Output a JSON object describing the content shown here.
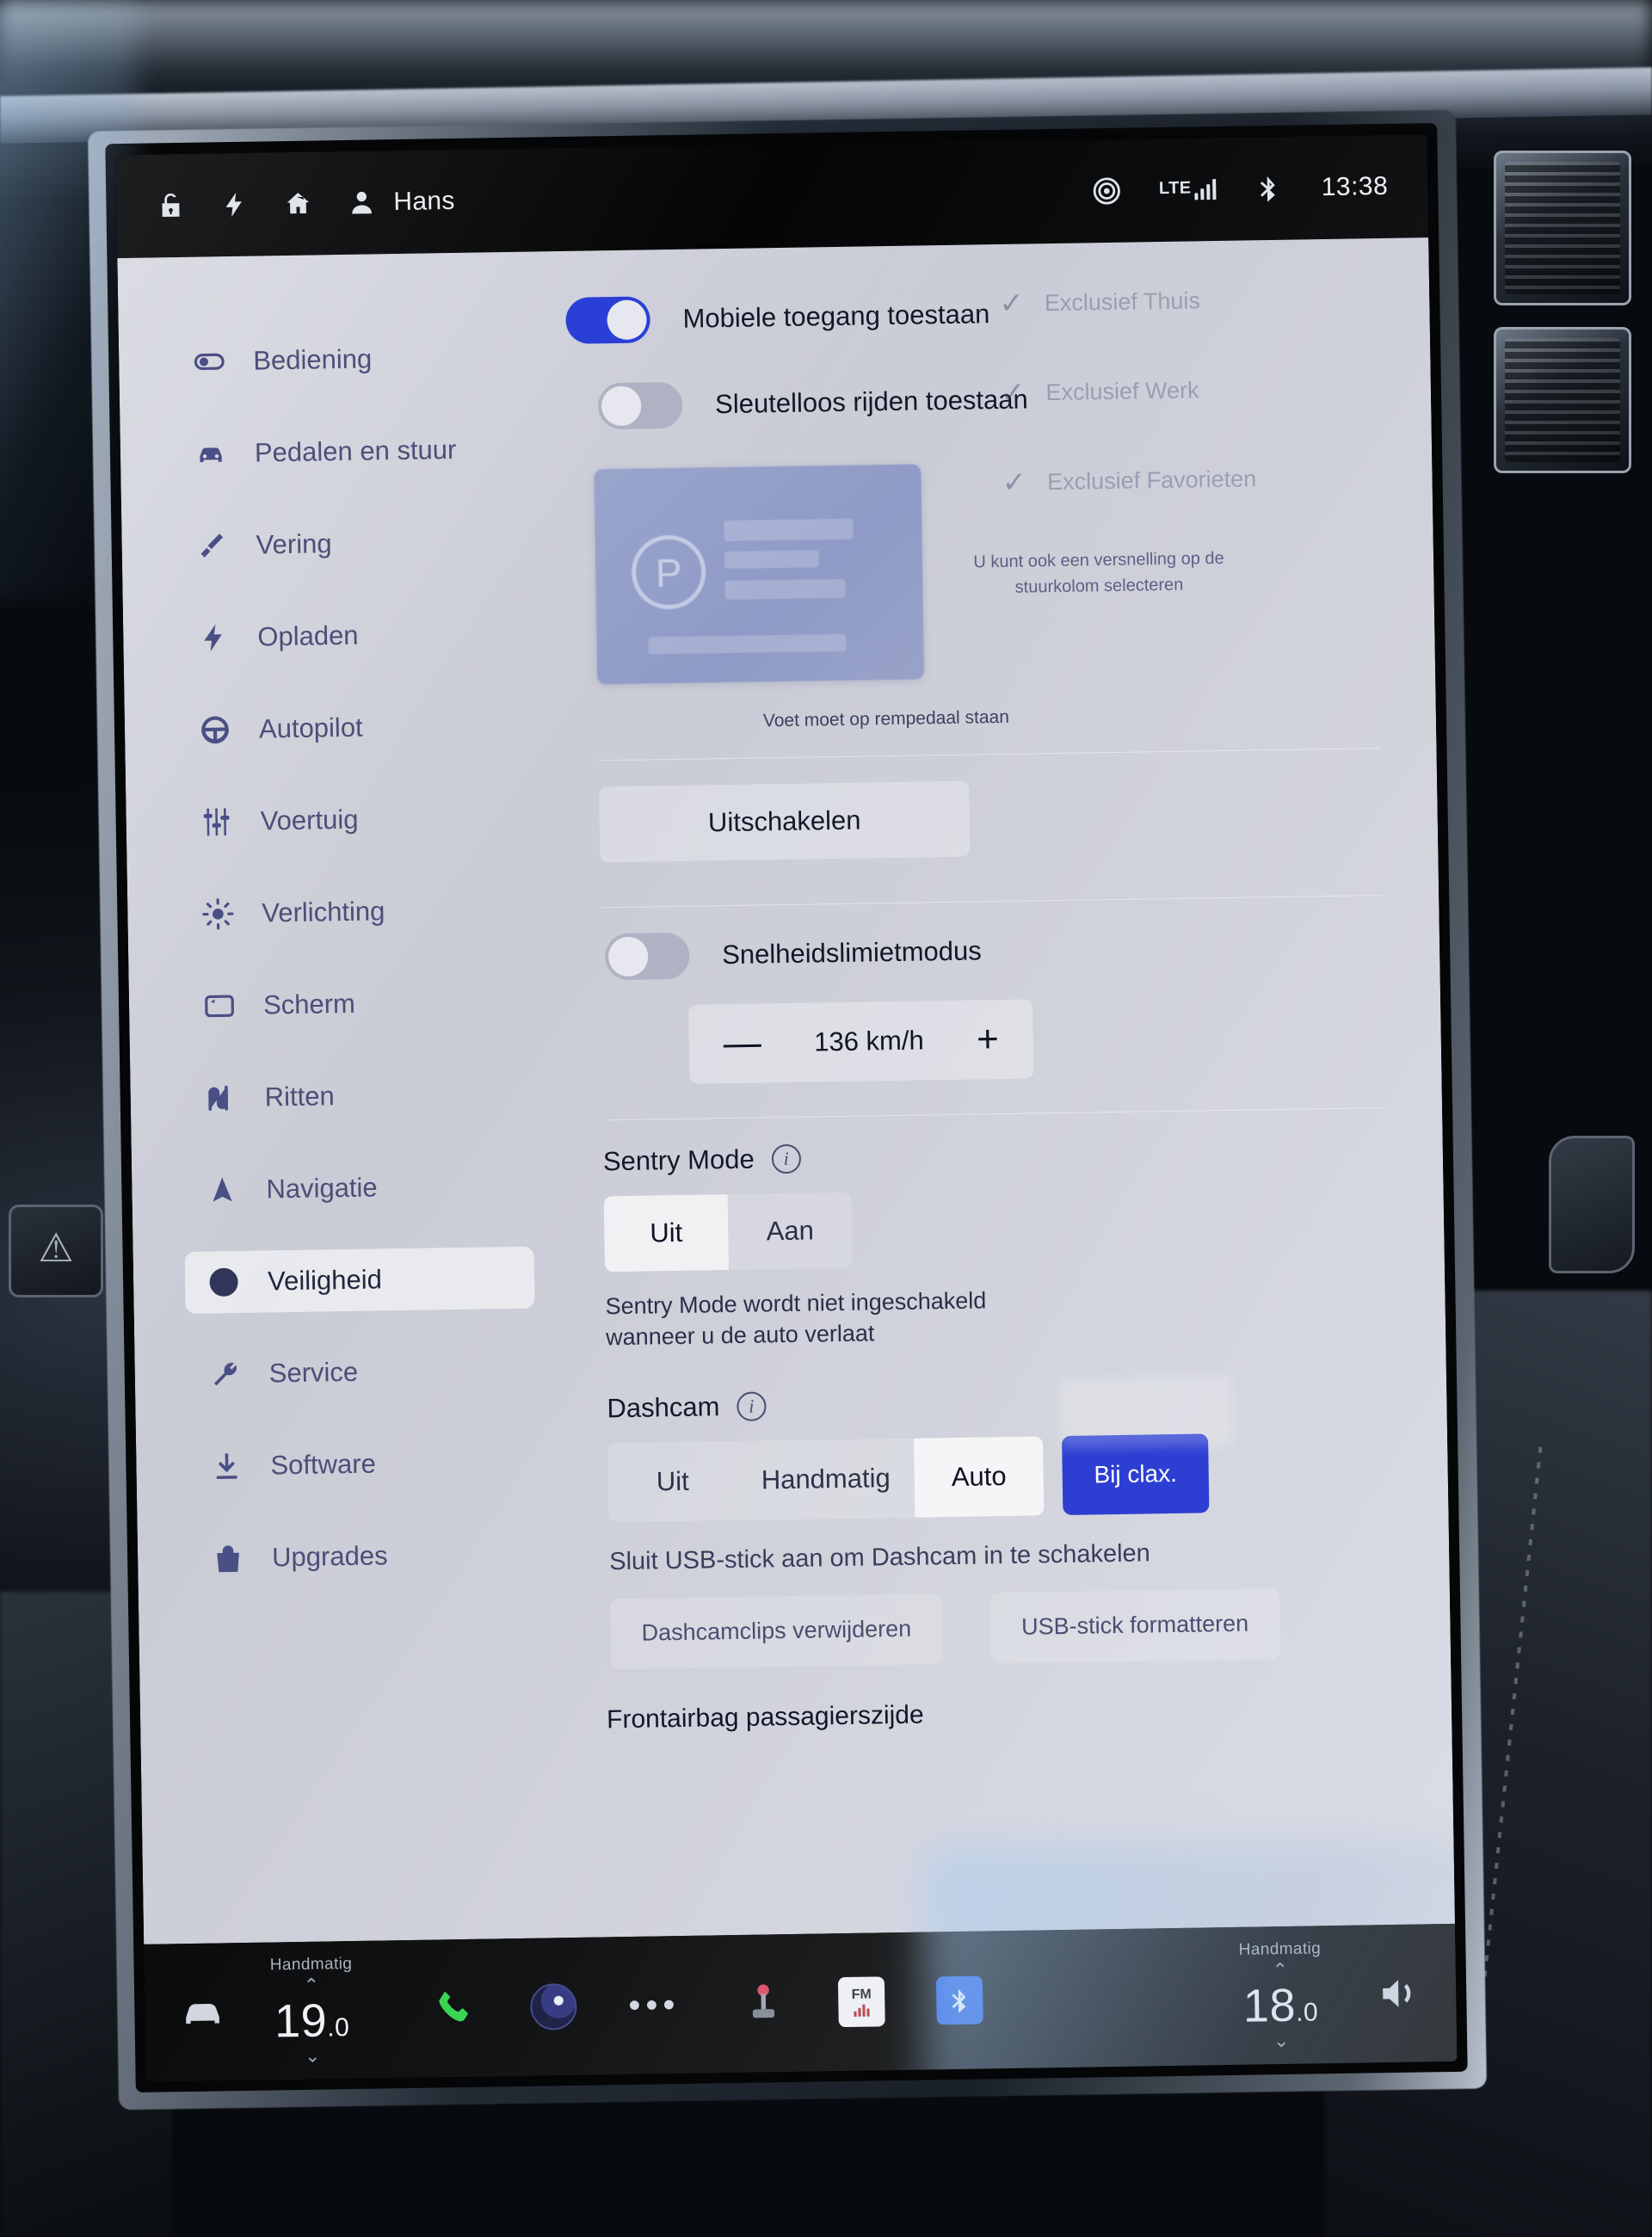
{
  "statusbar": {
    "icons_left": [
      "unlock-icon",
      "bolt-icon",
      "home-icon",
      "person-icon"
    ],
    "profile_name": "Hans",
    "network_label": "LTE",
    "icons_right": [
      "target-icon",
      "signal-bars-icon",
      "bluetooth-icon"
    ],
    "time": "13:38"
  },
  "sidebar": {
    "items": [
      {
        "label": "Bediening",
        "icon": "toggle-icon",
        "selected": false
      },
      {
        "label": "Pedalen en stuur",
        "icon": "car-icon",
        "selected": false
      },
      {
        "label": "Vering",
        "icon": "shock-absorber-icon",
        "selected": false
      },
      {
        "label": "Opladen",
        "icon": "bolt-icon",
        "selected": false
      },
      {
        "label": "Autopilot",
        "icon": "steering-wheel-icon",
        "selected": false
      },
      {
        "label": "Voertuig",
        "icon": "sliders-icon",
        "selected": false
      },
      {
        "label": "Verlichting",
        "icon": "sun-icon",
        "selected": false
      },
      {
        "label": "Scherm",
        "icon": "display-icon",
        "selected": false
      },
      {
        "label": "Ritten",
        "icon": "road-icon",
        "selected": false
      },
      {
        "label": "Navigatie",
        "icon": "navigation-arrow-icon",
        "selected": false
      },
      {
        "label": "Veiligheid",
        "icon": "alert-circle-icon",
        "selected": true
      },
      {
        "label": "Service",
        "icon": "wrench-icon",
        "selected": false
      },
      {
        "label": "Software",
        "icon": "download-icon",
        "selected": false
      },
      {
        "label": "Upgrades",
        "icon": "bag-icon",
        "selected": false
      }
    ]
  },
  "main": {
    "mobile_access": {
      "label": "Mobiele toegang toestaan",
      "state": "on"
    },
    "keyless_drive": {
      "label": "Sleutelloos rijden toestaan",
      "state": "off"
    },
    "gear_panel": {
      "icon": "parking-p-icon"
    },
    "gear_hint": "U kunt ook een versnelling op de stuurkolom selecteren",
    "brake_note": "Voet moet op rempedaal staan",
    "power_off_button": "Uitschakelen",
    "speed_limit": {
      "label": "Snelheidslimietmodus",
      "state": "off",
      "minus": "—",
      "value": "136 km/h",
      "plus": "+"
    },
    "sentry": {
      "title": "Sentry Mode",
      "info_icon": "info-icon",
      "options": [
        "Uit",
        "Aan"
      ],
      "selected": "Uit",
      "note": "Sentry Mode wordt niet ingeschakeld wanneer u de auto verlaat",
      "exclusions": [
        {
          "label": "Exclusief Thuis",
          "checked": true
        },
        {
          "label": "Exclusief Werk",
          "checked": true
        },
        {
          "label": "Exclusief Favorieten",
          "checked": true
        }
      ]
    },
    "dashcam": {
      "title": "Dashcam",
      "info_icon": "info-icon",
      "options": [
        "Uit",
        "Handmatig",
        "Auto"
      ],
      "selected": "Auto",
      "horn_button": "Bij clax.",
      "usb_note": "Sluit USB-stick aan om Dashcam in te schakelen",
      "delete_clips_button": "Dashcamclips verwijderen",
      "format_usb_button": "USB-stick formatteren"
    },
    "airbag_label": "Frontairbag passagierszijde"
  },
  "bottombar": {
    "car_icon": "car-icon",
    "left_climate": {
      "mode": "Handmatig",
      "temp": "19",
      "temp_decimal": ".0",
      "up": "⌃",
      "down": "⌄"
    },
    "phone_icon": "phone-icon",
    "media_icon": "media-icon",
    "more_icon": "ellipsis-icon",
    "joystick_icon": "joystick-icon",
    "fm_icon": "fm-radio-icon",
    "fm_label": "FM",
    "bluetooth_icon": "bluetooth-icon",
    "right_climate": {
      "mode": "Handmatig",
      "temp": "18",
      "temp_decimal": ".0",
      "up": "⌃",
      "down": "⌄"
    },
    "volume_icon": "volume-icon"
  },
  "colors": {
    "accent_blue": "#2a3fd6",
    "card_bg": "#c6c8d3",
    "bar_bg": "#030506",
    "phone_green": "#2fd24a",
    "bluetooth_blue": "#1f5ee8"
  }
}
